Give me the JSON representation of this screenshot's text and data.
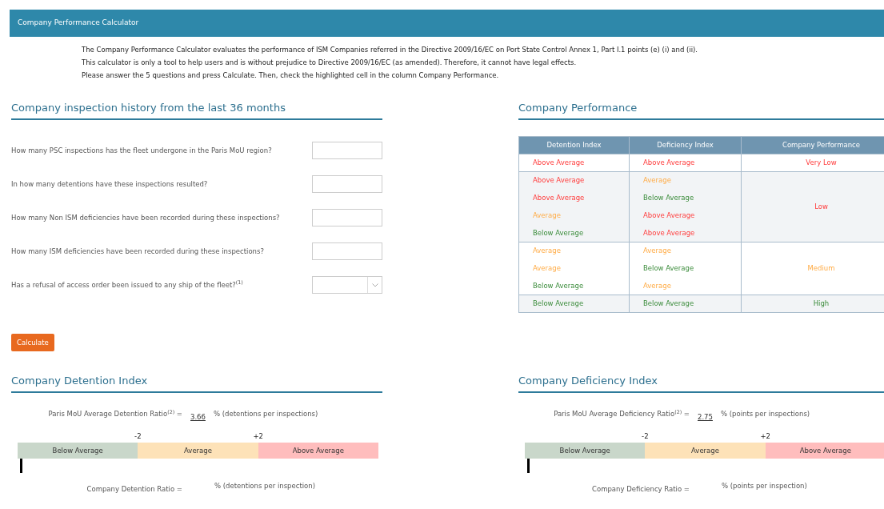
{
  "header": {
    "title": "Company Performance Calculator"
  },
  "intro": [
    "The Company Performance Calculator evaluates the performance of ISM Companies referred in the Directive 2009/16/EC on Port State Control Annex 1, Part I.1 points (e) (i) and (ii).",
    "This calculator is only a tool to help users and is without prejudice to Directive 2009/16/EC (as amended). Therefore, it cannot have legal effects.",
    "Please answer the 5 questions and press Calculate. Then, check the highlighted cell in the column Company Performance."
  ],
  "inspection_history": {
    "title": "Company inspection history from the last 36 months",
    "questions": [
      {
        "label": "How many PSC inspections has the fleet undergone in the Paris MoU region?",
        "kind": "text"
      },
      {
        "label": "In how many detentions have these inspections resulted?",
        "kind": "text"
      },
      {
        "label": "How many Non ISM deficiencies have been recorded during these inspections?",
        "kind": "text"
      },
      {
        "label": "How many ISM deficiencies have been recorded during these inspections?",
        "kind": "text"
      },
      {
        "label": "Has a refusal of access order been issued to any ship of the fleet?$^{(1)}$",
        "kind": "select"
      }
    ],
    "calculate_button": "Calculate"
  },
  "company_performance": {
    "title": "Company Performance",
    "columns": [
      "Detention Index",
      "Deficiency Index",
      "Company Performance"
    ],
    "groups": [
      {
        "performance": {
          "text": "Very Low",
          "kind": "bad"
        },
        "rows": [
          {
            "detention": {
              "text": "Above Average",
              "kind": "bad"
            },
            "deficiency": {
              "text": "Above Average",
              "kind": "bad"
            }
          }
        ]
      },
      {
        "performance": {
          "text": "Low",
          "kind": "bad"
        },
        "rows": [
          {
            "detention": {
              "text": "Above Average",
              "kind": "bad"
            },
            "deficiency": {
              "text": "Average",
              "kind": "mid"
            }
          },
          {
            "detention": {
              "text": "Above Average",
              "kind": "bad"
            },
            "deficiency": {
              "text": "Below Average",
              "kind": "good"
            }
          },
          {
            "detention": {
              "text": "Average",
              "kind": "mid"
            },
            "deficiency": {
              "text": "Above Average",
              "kind": "bad"
            }
          },
          {
            "detention": {
              "text": "Below Average",
              "kind": "good"
            },
            "deficiency": {
              "text": "Above Average",
              "kind": "bad"
            }
          }
        ]
      },
      {
        "performance": {
          "text": "Medium",
          "kind": "mid"
        },
        "rows": [
          {
            "detention": {
              "text": "Average",
              "kind": "mid"
            },
            "deficiency": {
              "text": "Average",
              "kind": "mid"
            }
          },
          {
            "detention": {
              "text": "Average",
              "kind": "mid"
            },
            "deficiency": {
              "text": "Below Average",
              "kind": "good"
            }
          },
          {
            "detention": {
              "text": "Below Average",
              "kind": "good"
            },
            "deficiency": {
              "text": "Average",
              "kind": "mid"
            }
          }
        ]
      },
      {
        "performance": {
          "text": "High",
          "kind": "good"
        },
        "rows": [
          {
            "detention": {
              "text": "Below Average",
              "kind": "good"
            },
            "deficiency": {
              "text": "Below Average",
              "kind": "good"
            }
          }
        ]
      }
    ]
  },
  "indices": [
    {
      "title": "Company Detention Index",
      "average_label": "Paris MoU Average Detention Ratio$^{(2)}$ =",
      "average_value": "3.66",
      "average_unit": "% (detentions per inspections)",
      "ticks": [
        "-2",
        "+2"
      ],
      "bands": [
        "Below Average",
        "Average",
        "Above Average"
      ],
      "marker": {
        "level": 0
      },
      "company_label": "Company Detention Ratio =",
      "company_unit": "% (detentions per inspection)"
    },
    {
      "title": "Company Deficiency Index",
      "average_label": "Paris MoU Average Deficiency Ratio$^{(2)}$ =",
      "average_value": "2.75",
      "average_unit": "% (points per inspections)",
      "ticks": [
        "-2",
        "+2"
      ],
      "bands": [
        "Below Average",
        "Average",
        "Above Average"
      ],
      "marker": {
        "level": 0
      },
      "company_label": "Company Deficiency Ratio =",
      "company_unit": "% (points per inspection)"
    }
  ]
}
